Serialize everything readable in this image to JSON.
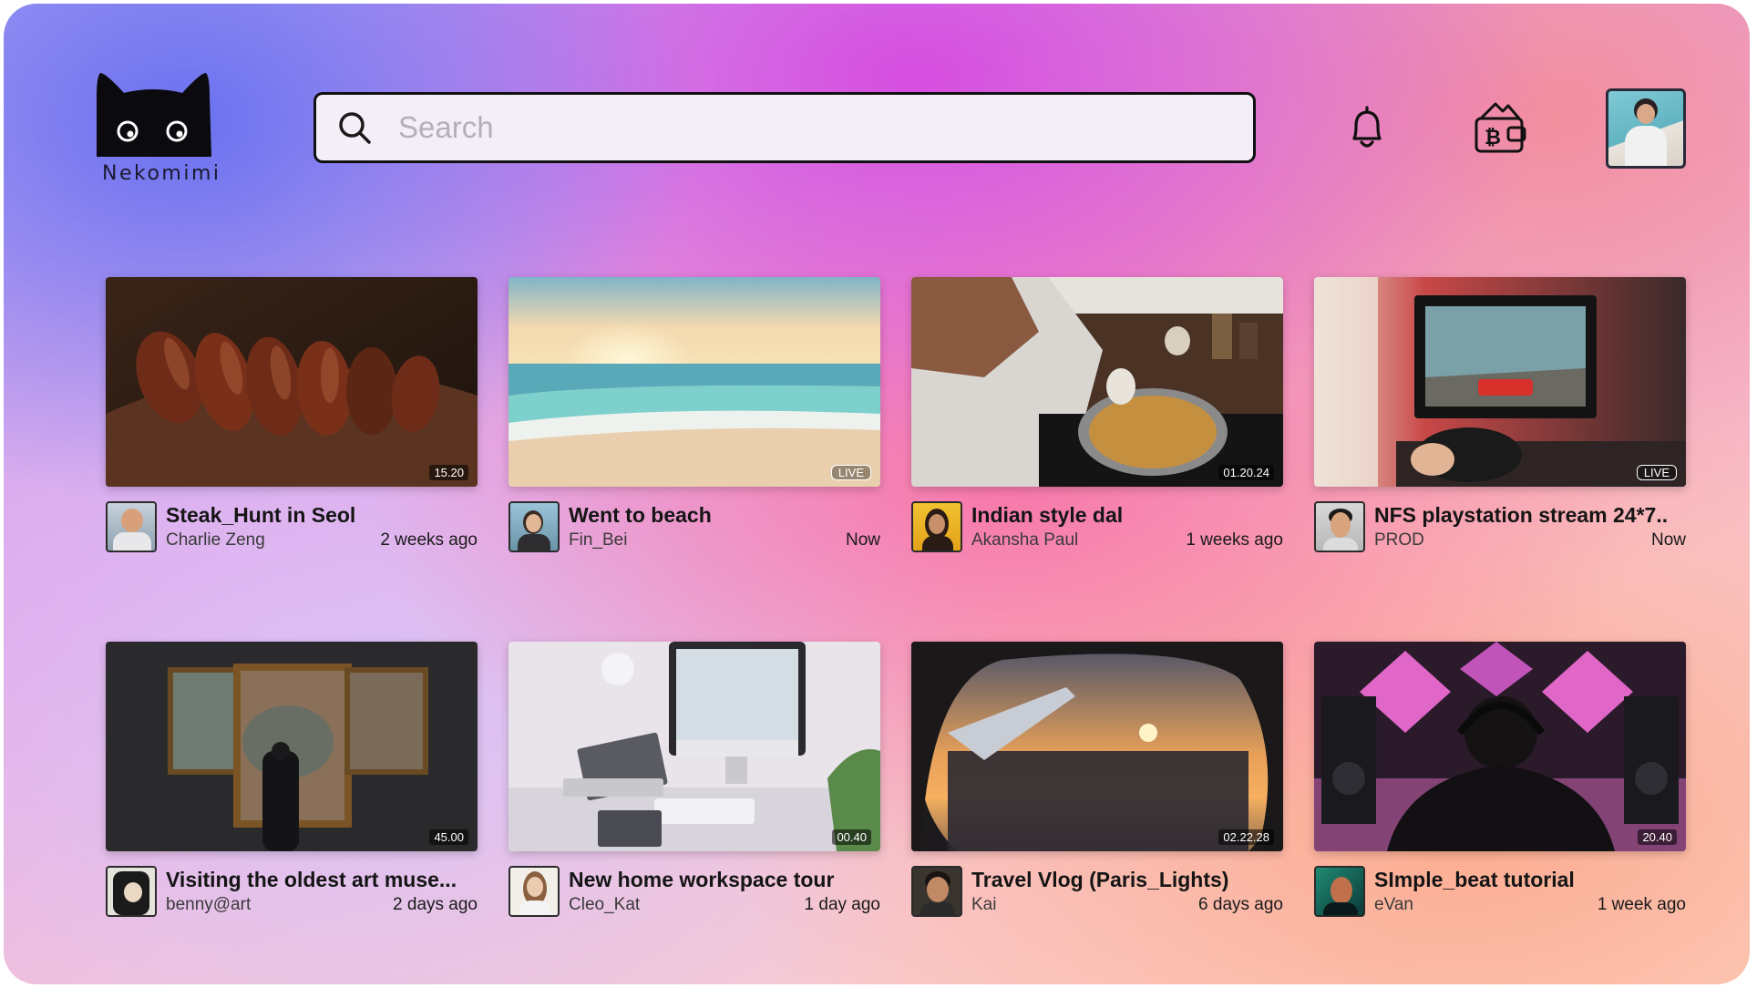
{
  "brand": {
    "name": "Nekomimi",
    "logo_icon": "cat-face-icon"
  },
  "search": {
    "placeholder": "Search",
    "value": ""
  },
  "header_icons": [
    "bell-icon",
    "bitcoin-wallet-icon",
    "profile-avatar"
  ],
  "videos": [
    {
      "title": "Steak_Hunt in Seol",
      "channel": "Charlie Zeng",
      "time": "2 weeks ago",
      "badge": "15.20",
      "live": false
    },
    {
      "title": "Went to beach",
      "channel": "Fin_Bei",
      "time": "Now",
      "badge": "LIVE",
      "live": true
    },
    {
      "title": "Indian style dal",
      "channel": "Akansha Paul",
      "time": "1 weeks ago",
      "badge": "01.20.24",
      "live": false
    },
    {
      "title": "NFS playstation stream 24*7..",
      "channel": "PROD",
      "time": "Now",
      "badge": "LIVE",
      "live": true
    },
    {
      "title": "Visiting the oldest art muse...",
      "channel": "benny@art",
      "time": "2 days ago",
      "badge": "45.00",
      "live": false
    },
    {
      "title": "New home workspace tour",
      "channel": "Cleo_Kat",
      "time": "1 day ago",
      "badge": "00.40",
      "live": false
    },
    {
      "title": "Travel Vlog (Paris_Lights)",
      "channel": "Kai",
      "time": "6 days ago",
      "badge": "02.22.28",
      "live": false
    },
    {
      "title": "SImple_beat tutorial",
      "channel": "eVan",
      "time": "1 week ago",
      "badge": "20.40",
      "live": false
    }
  ]
}
